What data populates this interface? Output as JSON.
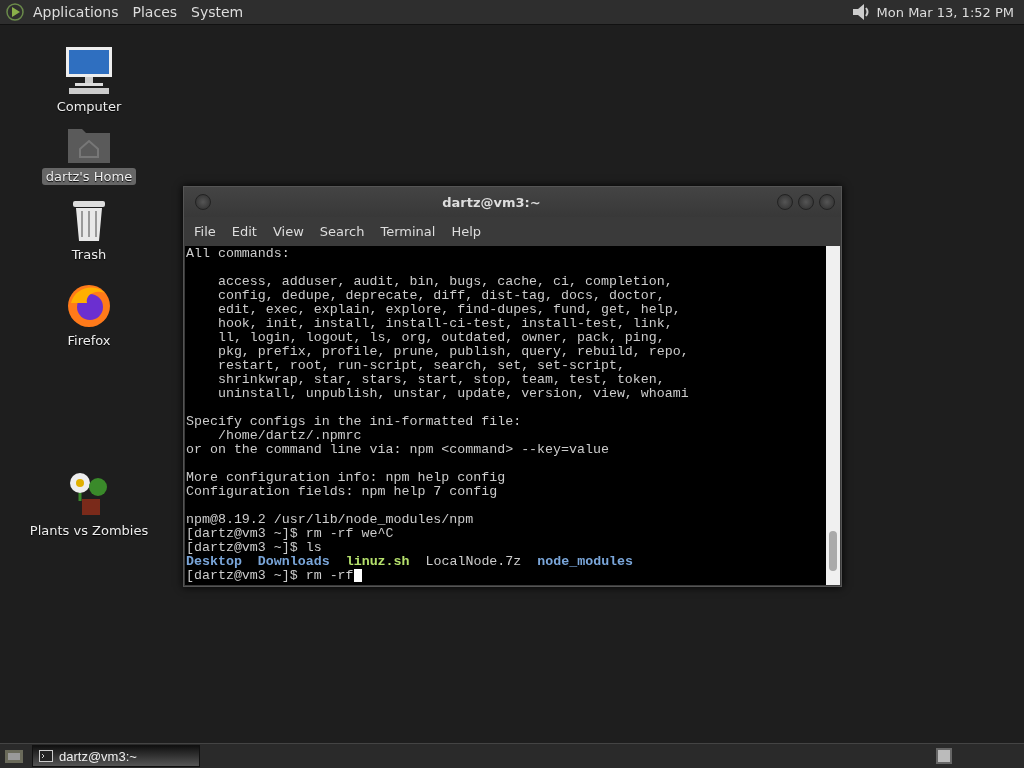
{
  "top_panel": {
    "menus": [
      "Applications",
      "Places",
      "System"
    ],
    "clock": "Mon Mar 13, 1:52 PM"
  },
  "desktop_icons": [
    {
      "label": "Computer",
      "kind": "computer",
      "selected": false
    },
    {
      "label": "dartz's Home",
      "kind": "home",
      "selected": true
    },
    {
      "label": "Trash",
      "kind": "trash",
      "selected": false
    },
    {
      "label": "Firefox",
      "kind": "browser",
      "selected": false
    },
    {
      "label": "Plants vs Zombies",
      "kind": "game",
      "selected": false
    }
  ],
  "terminal": {
    "title": "dartz@vm3:~",
    "menu": [
      "File",
      "Edit",
      "View",
      "Search",
      "Terminal",
      "Help"
    ],
    "blocks": [
      {
        "lines": [
          {
            "text": "All commands:"
          }
        ]
      },
      {
        "lines": [
          {
            "text": "    access, adduser, audit, bin, bugs, cache, ci, completion,"
          },
          {
            "text": "    config, dedupe, deprecate, diff, dist-tag, docs, doctor,"
          },
          {
            "text": "    edit, exec, explain, explore, find-dupes, fund, get, help,"
          },
          {
            "text": "    hook, init, install, install-ci-test, install-test, link,"
          },
          {
            "text": "    ll, login, logout, ls, org, outdated, owner, pack, ping,"
          },
          {
            "text": "    pkg, prefix, profile, prune, publish, query, rebuild, repo,"
          },
          {
            "text": "    restart, root, run-script, search, set, set-script,"
          },
          {
            "text": "    shrinkwrap, star, stars, start, stop, team, test, token,"
          },
          {
            "text": "    uninstall, unpublish, unstar, update, version, view, whoami"
          }
        ]
      },
      {
        "lines": [
          {
            "text": "Specify configs in the ini-formatted file:"
          },
          {
            "text": "    /home/dartz/.npmrc"
          },
          {
            "text": "or on the command line via: npm <command> --key=value"
          }
        ]
      },
      {
        "lines": [
          {
            "text": "More configuration info: npm help config"
          },
          {
            "text": "Configuration fields: npm help 7 config"
          }
        ]
      },
      {
        "lines": [
          {
            "text": "npm@8.19.2 /usr/lib/node_modules/npm"
          },
          {
            "text": "[dartz@vm3 ~]$ rm -rf we^C"
          },
          {
            "text": "[dartz@vm3 ~]$ ls"
          },
          {
            "entries": [
              {
                "name": "Desktop",
                "kind": "dir"
              },
              {
                "name": "Downloads",
                "kind": "dir"
              },
              {
                "name": "linuz.sh",
                "kind": "exec"
              },
              {
                "name": "LocalNode.7z",
                "kind": "file"
              },
              {
                "name": "node_modules",
                "kind": "dir"
              }
            ]
          },
          {
            "text": "[dartz@vm3 ~]$ rm -rf",
            "cursor": true
          }
        ]
      }
    ]
  },
  "taskbar": {
    "tasks": [
      {
        "label": "dartz@vm3:~",
        "selected": true
      }
    ]
  }
}
